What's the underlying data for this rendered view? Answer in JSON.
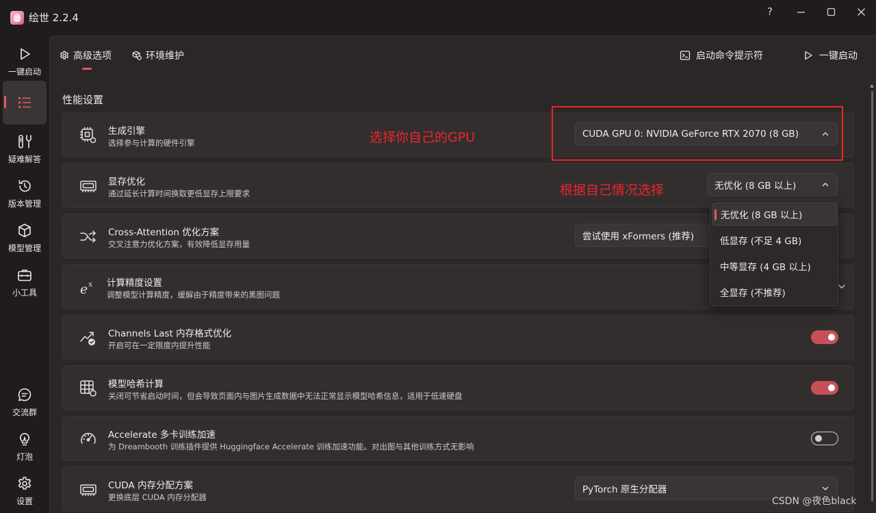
{
  "app": {
    "title": "绘世 2.2.4"
  },
  "window_controls": {
    "help": "?"
  },
  "nav": {
    "top": [
      {
        "label": "一键启动",
        "icon": "play-icon"
      },
      {
        "label": "",
        "icon": "list-icon"
      },
      {
        "label": "疑难解答",
        "icon": "tools-icon"
      },
      {
        "label": "版本管理",
        "icon": "history-icon"
      },
      {
        "label": "模型管理",
        "icon": "cube-icon"
      },
      {
        "label": "小工具",
        "icon": "toolbox-icon"
      }
    ],
    "bottom": [
      {
        "label": "交流群",
        "icon": "chat-icon"
      },
      {
        "label": "灯泡",
        "icon": "bulb-icon"
      },
      {
        "label": "设置",
        "icon": "gear-icon"
      }
    ]
  },
  "tabs": [
    {
      "label": "高级选项",
      "icon": "gear-icon"
    },
    {
      "label": "环境维护",
      "icon": "box-refresh-icon"
    }
  ],
  "top_actions": [
    {
      "label": "启动命令提示符",
      "icon": "terminal-icon"
    },
    {
      "label": "一键启动",
      "icon": "play-icon"
    }
  ],
  "section": {
    "title": "性能设置"
  },
  "settings": [
    {
      "title": "生成引擎",
      "desc": "选择参与计算的硬件引擎",
      "control": "select",
      "value": "CUDA GPU 0: NVIDIA GeForce RTX 2070 (8 GB)"
    },
    {
      "title": "显存优化",
      "desc": "通过延长计算时间换取更低显存上限要求",
      "control": "select",
      "value": "无优化 (8 GB 以上)"
    },
    {
      "title": "Cross-Attention 优化方案",
      "desc": "交叉注意力优化方案，有效降低显存用量",
      "control": "select",
      "value": "尝试使用 xFormers (推荐)"
    },
    {
      "title": "计算精度设置",
      "desc": "调整模型计算精度，缓解由于精度带来的黑图问题",
      "control": "expander"
    },
    {
      "title": "Channels Last 内存格式优化",
      "desc": "开启可在一定限度内提升性能",
      "control": "toggle",
      "state": "on"
    },
    {
      "title": "模型哈希计算",
      "desc": "关闭可节省启动时间，但会导致页面内与图片生成数据中无法正常显示模型哈希信息，适用于低速硬盘",
      "control": "toggle",
      "state": "on"
    },
    {
      "title": "Accelerate 多卡训练加速",
      "desc": "为 Dreambooth 训练插件提供 Huggingface Accelerate 训练加速功能。对出图与其他训练方式无影响",
      "control": "toggle",
      "state": "off"
    },
    {
      "title": "CUDA 内存分配方案",
      "desc": "更换底层 CUDA 内存分配器",
      "control": "select",
      "value": "PyTorch 原生分配器"
    }
  ],
  "vram_dropdown": {
    "options": [
      "无优化 (8 GB 以上)",
      "低显存 (不足 4 GB)",
      "中等显存 (4 GB 以上)",
      "全显存 (不推荐)"
    ],
    "selected": "无优化 (8 GB 以上)"
  },
  "annotations": {
    "gpu_note": "选择你自己的GPU",
    "vram_note": "根据自己情况选择",
    "color": "#e8262b"
  },
  "watermark": "CSDN @夜色black",
  "colors": {
    "accent": "#e05a62",
    "toggle_on": "#c75058"
  }
}
